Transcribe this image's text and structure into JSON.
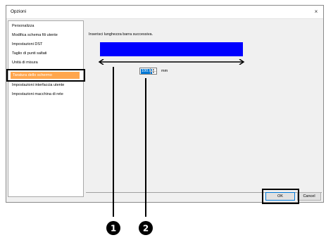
{
  "window": {
    "title": "Opzioni",
    "close_glyph": "×"
  },
  "sidebar": {
    "items": [
      {
        "label": "Personalizza"
      },
      {
        "label": "Modifica schema fili utente"
      },
      {
        "label": "Impostazioni DST"
      },
      {
        "label": "Taglio di punti saltati"
      },
      {
        "label": "Unità di misura"
      },
      {
        "label": "Taratura dello schermo"
      },
      {
        "label": "Impostazioni interfaccia utente"
      },
      {
        "label": "Impostazioni macchina di rete"
      }
    ],
    "selected_index": 5
  },
  "main": {
    "instruction": "Inserisci lunghezza barra successiva.",
    "bar_color": "#0000ff",
    "length_value": "100.0",
    "unit": "mm"
  },
  "buttons": {
    "ok_label": "OK",
    "cancel_label": "Cancel"
  },
  "callouts": [
    {
      "number": "1"
    },
    {
      "number": "2"
    }
  ],
  "colors": {
    "selection": "#ffa64d",
    "bar": "#0000ff",
    "badge": "#000000"
  }
}
